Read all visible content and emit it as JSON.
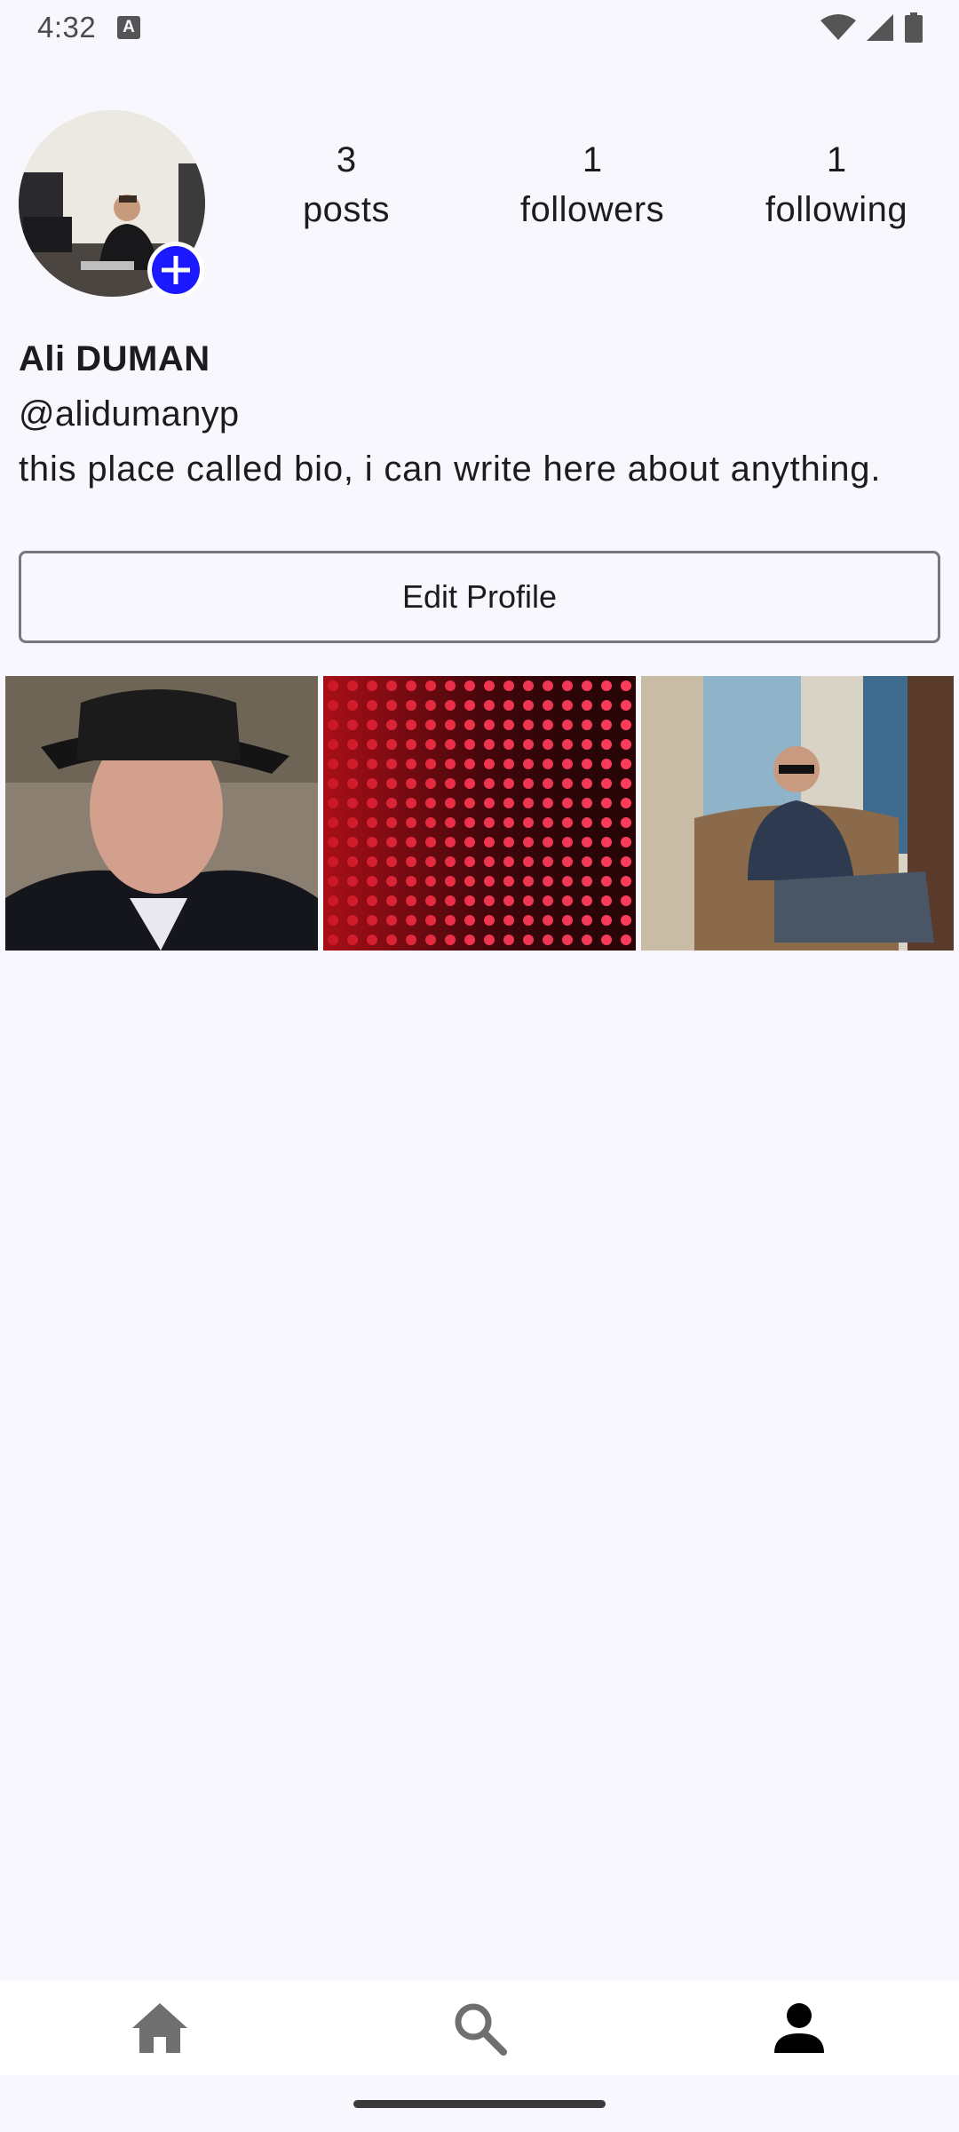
{
  "status_bar": {
    "time": "4:32",
    "notification_icon_letter": "A",
    "icons": [
      "wifi-icon",
      "signal-icon",
      "battery-icon"
    ]
  },
  "profile": {
    "stats": [
      {
        "value": "3",
        "label": "posts"
      },
      {
        "value": "1",
        "label": "followers"
      },
      {
        "value": "1",
        "label": "following"
      }
    ],
    "name": "Ali DUMAN",
    "handle": "@alidumanyp",
    "bio": "this place called bio, i can write here about anything.",
    "edit_button_label": "Edit Profile"
  },
  "posts": [
    {
      "description": "man-in-black-hat"
    },
    {
      "description": "red-led-wall"
    },
    {
      "description": "man-sitting-in-armchair"
    }
  ],
  "bottom_nav": {
    "items": [
      "home-icon",
      "search-icon",
      "person-icon"
    ],
    "active": "person-icon"
  },
  "colors": {
    "background": "#f8f7fe",
    "accent_add_button": "#1a19ff",
    "active_nav_icon": "#000000",
    "inactive_nav_icon": "#6f6f6f"
  }
}
